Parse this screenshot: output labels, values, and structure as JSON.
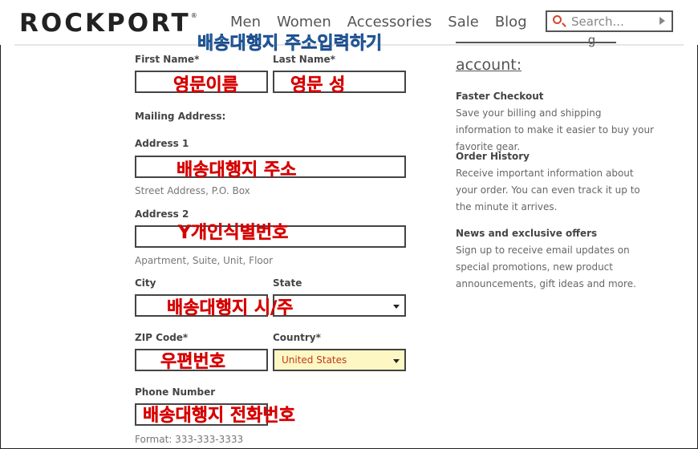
{
  "header": {
    "logo": "ROCKPORT",
    "logo_mark": "®",
    "nav": [
      "Men",
      "Women",
      "Accessories",
      "Sale",
      "Blog"
    ],
    "search_placeholder": "Search..."
  },
  "annotations": {
    "top": "배송대행지 주소입력하기",
    "first_name": "영문이름",
    "last_name": "영문 성",
    "address1": "배송대행지 주소",
    "address2": "Y개인식별번호",
    "city_state": "배송대행지 시/주",
    "zip": "우편번호",
    "phone": "배송대행지 전화번호"
  },
  "form": {
    "first_name_label": "First Name*",
    "last_name_label": "Last Name*",
    "mailing_label": "Mailing Address:",
    "address1_label": "Address 1",
    "address1_hint": "Street Address, P.O. Box",
    "address2_label": "Address 2",
    "address2_hint": "Apartment, Suite, Unit, Floor",
    "city_label": "City",
    "state_label": "State",
    "state_value": "...",
    "zip_label": "ZIP Code*",
    "country_label": "Country*",
    "country_value": "United States",
    "phone_label": "Phone Number",
    "phone_hint": "Format: 333-333-3333"
  },
  "sidebar": {
    "partial_char": "g",
    "title": "account:",
    "sections": [
      {
        "heading": "Faster Checkout",
        "text": "Save your billing and shipping information to make it easier to buy your favorite gear."
      },
      {
        "heading": "Order History",
        "text": "Receive important information about your order. You can even track it up to the minute it arrives."
      },
      {
        "heading": "News and exclusive offers",
        "text": "Sign up to receive email updates on special promotions, new product announcements, gift ideas and more."
      }
    ]
  },
  "colors": {
    "accent": "#d4472b",
    "annotation_red": "#d60000",
    "annotation_blue": "#3aa0e0",
    "country_bg": "#fdf7c4"
  }
}
